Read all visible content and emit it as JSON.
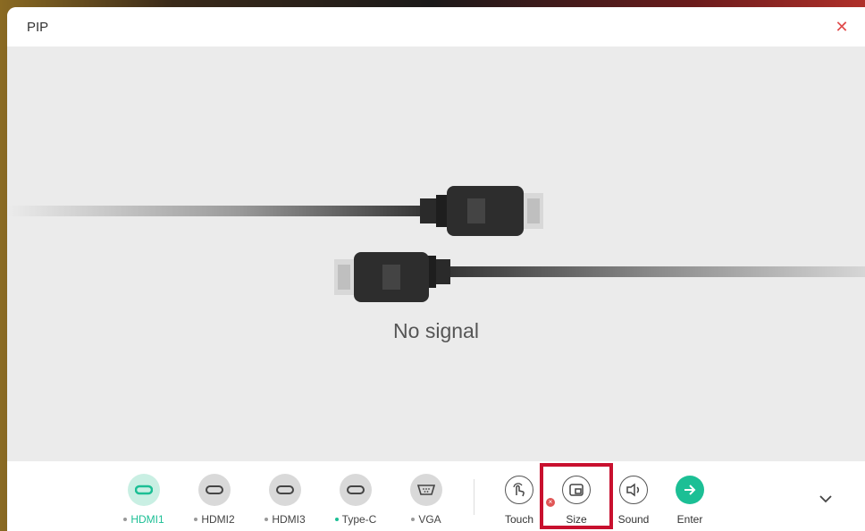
{
  "window": {
    "title": "PIP",
    "close_icon": "close-icon",
    "accent_color": "#1cbf95",
    "close_color": "#e04a4a"
  },
  "video": {
    "status_text": "No signal"
  },
  "sources": [
    {
      "label": "HDMI1",
      "icon": "hdmi-icon",
      "active": true,
      "connected": true
    },
    {
      "label": "HDMI2",
      "icon": "hdmi-icon",
      "active": false,
      "connected": false
    },
    {
      "label": "HDMI3",
      "icon": "hdmi-icon",
      "active": false,
      "connected": false
    },
    {
      "label": "Type-C",
      "icon": "usb-c-icon",
      "active": false,
      "connected": true
    },
    {
      "label": "VGA",
      "icon": "vga-icon",
      "active": false,
      "connected": false
    }
  ],
  "controls": {
    "touch_label": "Touch",
    "size_label": "Size",
    "sound_label": "Sound",
    "enter_label": "Enter"
  }
}
